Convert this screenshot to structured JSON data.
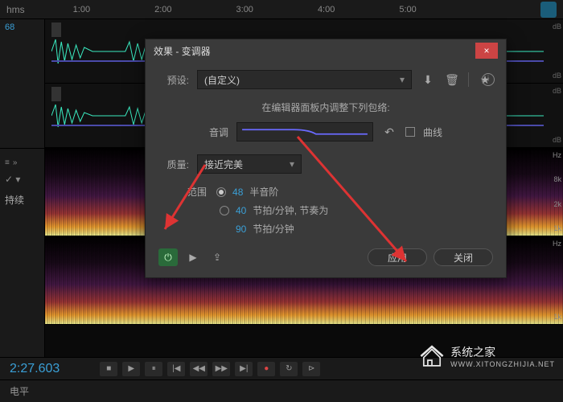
{
  "ruler": {
    "label": "hms",
    "ticks": [
      "1:00",
      "2:00",
      "3:00",
      "4:00",
      "5:00"
    ]
  },
  "sidebar": {
    "number": "68",
    "hold_label": "持续"
  },
  "db_unit": "dB",
  "hz_labels": {
    "unit": "Hz",
    "k8": "8k",
    "k2": "2k",
    "k1": "1k"
  },
  "timecode": "2:27.603",
  "statusbar": {
    "level_label": "电平"
  },
  "dialog": {
    "title": "效果 - 变调器",
    "preset_label": "预设:",
    "preset_value": "(自定义)",
    "hint": "在编辑器面板内调整下列包络:",
    "pitch_label": "音调",
    "curve_label": "曲线",
    "quality_label": "质量:",
    "quality_value": "接近完美",
    "range_label": "范围",
    "semitone_value": "48",
    "semitone_unit": "半音阶",
    "bpm_value": "40",
    "bpm_unit": "节拍/分钟, 节奏为",
    "bpm2_value": "90",
    "bpm2_unit": "节拍/分钟",
    "apply_label": "应用",
    "close_label": "关闭"
  },
  "watermark": {
    "name": "系统之家",
    "url": "WWW.XITONGZHIJIA.NET"
  }
}
